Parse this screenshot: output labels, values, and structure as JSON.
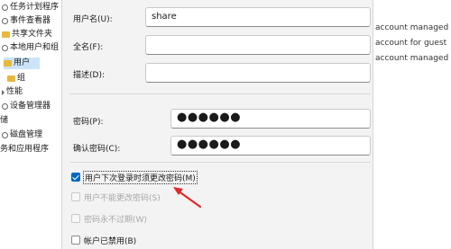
{
  "tree": {
    "items": [
      {
        "label": "任务计划程序",
        "icon": "gear-icon"
      },
      {
        "label": "事件查看器",
        "icon": "gear-icon"
      },
      {
        "label": "共享文件夹",
        "icon": "folder-icon"
      },
      {
        "label": "本地用户和组",
        "icon": "gear-icon"
      },
      {
        "label": "用户",
        "icon": "folder-icon",
        "selected": true
      },
      {
        "label": "组",
        "icon": "folder-icon"
      },
      {
        "label": "性能",
        "icon": "chevron-right-icon"
      },
      {
        "label": "设备管理器",
        "icon": "gear-icon"
      },
      {
        "label": "储",
        "icon": ""
      },
      {
        "label": "磁盘管理",
        "icon": ""
      },
      {
        "label": "务和应用程序",
        "icon": ""
      }
    ]
  },
  "dialog": {
    "fields": {
      "username_label": "用户名(U):",
      "username_value": "share",
      "fullname_label": "全名(F):",
      "fullname_value": "",
      "description_label": "描述(D):",
      "description_value": "",
      "password_label": "密码(P):",
      "password_value": "●●●●●●",
      "confirm_label": "确认密码(C):",
      "confirm_value": "●●●●●●"
    },
    "options": {
      "must_change": {
        "label": "用户下次登录时须更改密码(M)",
        "checked": true,
        "disabled": false
      },
      "cannot_change": {
        "label": "用户不能更改密码(S)",
        "checked": false,
        "disabled": true
      },
      "never_expires": {
        "label": "密码永不过期(W)",
        "checked": false,
        "disabled": true
      },
      "account_disabled": {
        "label": "帐户已禁用(B)",
        "checked": false,
        "disabled": false
      }
    }
  },
  "right_pane": {
    "rows": [
      "account managed",
      "account for guest",
      "account managed"
    ]
  },
  "colors": {
    "accent": "#0067c0",
    "annotation_arrow": "#e0282a"
  }
}
